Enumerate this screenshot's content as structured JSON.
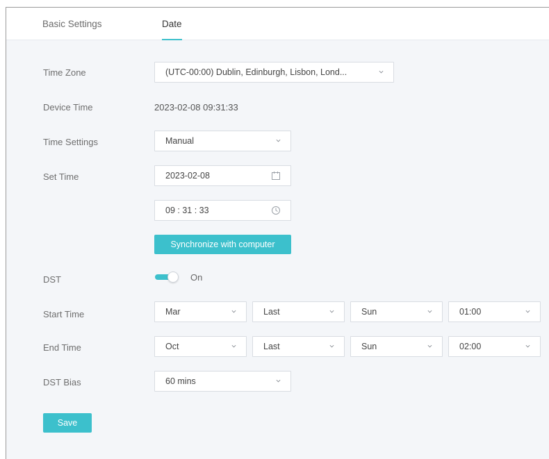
{
  "tabs": [
    {
      "label": "Basic Settings"
    },
    {
      "label": "Date"
    }
  ],
  "time_zone": {
    "label": "Time Zone",
    "value": "(UTC-00:00) Dublin, Edinburgh, Lisbon, Lond..."
  },
  "device_time": {
    "label": "Device Time",
    "value": "2023-02-08 09:31:33"
  },
  "time_settings": {
    "label": "Time Settings",
    "value": "Manual"
  },
  "set_time": {
    "label": "Set Time",
    "date": "2023-02-08",
    "time": "09 : 31 : 33",
    "sync_button": "Synchronize with computer"
  },
  "dst": {
    "label": "DST",
    "state": "On",
    "enabled": true
  },
  "start_time": {
    "label": "Start Time",
    "month": "Mar",
    "week": "Last",
    "day": "Sun",
    "time": "01:00"
  },
  "end_time": {
    "label": "End Time",
    "month": "Oct",
    "week": "Last",
    "day": "Sun",
    "time": "02:00"
  },
  "dst_bias": {
    "label": "DST Bias",
    "value": "60 mins"
  },
  "save_button": "Save",
  "colors": {
    "accent": "#3cc0cc",
    "background": "#f4f6f9",
    "border": "#d8dce2"
  },
  "icons": [
    "chevron-down-icon",
    "calendar-icon",
    "clock-icon"
  ]
}
